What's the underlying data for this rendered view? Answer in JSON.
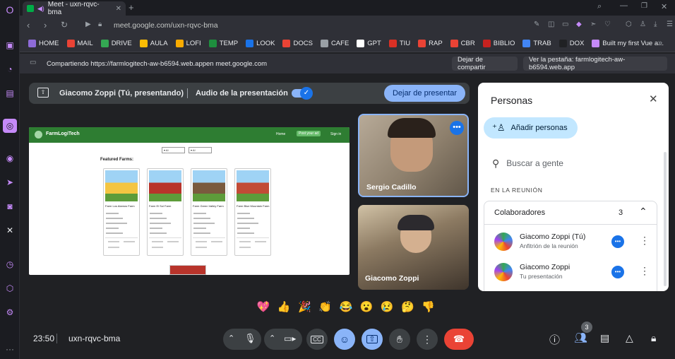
{
  "browser": {
    "tab_title": "Meet - uxn-rqvc-bma",
    "url": "meet.google.com/uxn-rqvc-bma",
    "bookmarks": [
      {
        "label": "HOME",
        "color": "#8e6bd8"
      },
      {
        "label": "MAIL",
        "color": "#ea4335"
      },
      {
        "label": "DRIVE",
        "color": "#34a853"
      },
      {
        "label": "AULA",
        "color": "#fbbc04"
      },
      {
        "label": "LOFI",
        "color": "#f9ab00"
      },
      {
        "label": "TEMP",
        "color": "#1e8e3e"
      },
      {
        "label": "LOOK",
        "color": "#1a73e8"
      },
      {
        "label": "DOCS",
        "color": "#ea4335"
      },
      {
        "label": "CAFE",
        "color": "#9aa0a6"
      },
      {
        "label": "GPT",
        "color": "#ffffff"
      },
      {
        "label": "TIU",
        "color": "#d93025"
      },
      {
        "label": "RAP",
        "color": "#ea4335"
      },
      {
        "label": "CBR",
        "color": "#ea4335"
      },
      {
        "label": "BIBLIO",
        "color": "#c5221f"
      },
      {
        "label": "TRAB",
        "color": "#4285f4"
      },
      {
        "label": "DOX",
        "color": "#202124"
      },
      {
        "label": "Built my first Vue a...",
        "color": "#c58af9"
      }
    ]
  },
  "sharebar": {
    "text": "Compartiendo https://farmlogitech-aw-b6594.web.appen meet.google.com",
    "stop_label": "Dejar de compartir",
    "view_tab_label": "Ver la pestaña: farmlogitech-aw-b6594.web.app"
  },
  "presentation_bar": {
    "presenter": "Giacomo Zoppi (Tú, presentando)",
    "audio_label": "Audio de la presentación",
    "stop_label": "Dejar de presentar"
  },
  "shared_site": {
    "brand": "FarmLogiTech",
    "nav": [
      "Home",
      "Post your ad",
      "Sign in"
    ],
    "filters": [
      "Al",
      "Al"
    ],
    "heading": "Featured Farms:",
    "farms": [
      {
        "name": "Farm Los Alamos Farm",
        "color": "#f4c542"
      },
      {
        "name": "Farm El Sol Farm",
        "color": "#b8342b"
      },
      {
        "name": "Farm Green Valley Farm",
        "color": "#7a5a3e"
      },
      {
        "name": "Farm Blue Mountain Farm",
        "color": "#c24b36"
      }
    ]
  },
  "participants": [
    {
      "name": "Sergio Cadillo"
    },
    {
      "name": "Giacomo Zoppi"
    }
  ],
  "people_panel": {
    "title": "Personas",
    "add_label": "Añadir personas",
    "search_placeholder": "Buscar a gente",
    "section_label": "EN LA REUNIÓN",
    "group_label": "Colaboradores",
    "group_count": "3",
    "members": [
      {
        "name": "Giacomo Zoppi (Tú)",
        "role": "Anfitrión de la reunión"
      },
      {
        "name": "Giacomo Zoppi",
        "role": "Tu presentación"
      }
    ]
  },
  "reactions": [
    "💖",
    "👍",
    "🎉",
    "👏",
    "😂",
    "😮",
    "😢",
    "🤔",
    "👎"
  ],
  "footer": {
    "time": "23:50",
    "meeting_code": "uxn-rqvc-bma",
    "people_badge": "3"
  }
}
